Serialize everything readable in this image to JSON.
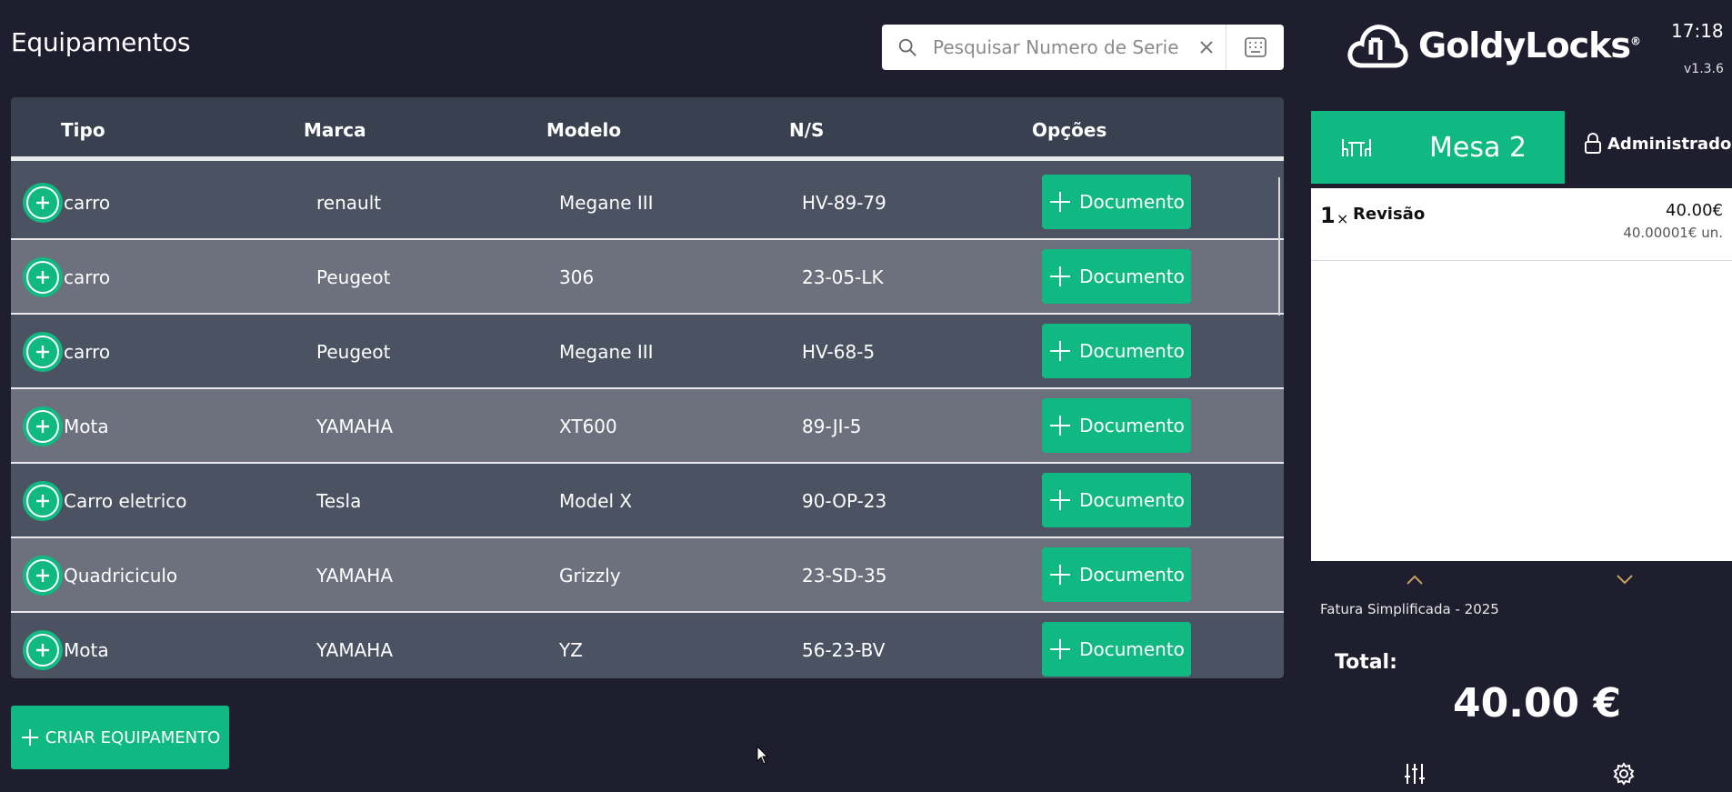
{
  "page": {
    "title": "Equipamentos"
  },
  "search": {
    "placeholder": "Pesquisar Numero de Serie",
    "value": ""
  },
  "table": {
    "headers": {
      "tipo": "Tipo",
      "marca": "Marca",
      "modelo": "Modelo",
      "ns": "N/S",
      "opcoes": "Opções"
    },
    "document_label": "Documento",
    "rows": [
      {
        "tipo": "carro",
        "marca": "renault",
        "modelo": "Megane III",
        "ns": "HV-89-79"
      },
      {
        "tipo": "carro",
        "marca": "Peugeot",
        "modelo": "306",
        "ns": "23-05-LK"
      },
      {
        "tipo": "carro",
        "marca": "Peugeot",
        "modelo": "Megane III",
        "ns": "HV-68-5"
      },
      {
        "tipo": "Mota",
        "marca": "YAMAHA",
        "modelo": "XT600",
        "ns": "89-JI-5"
      },
      {
        "tipo": "Carro eletrico",
        "marca": "Tesla",
        "modelo": "Model X",
        "ns": "90-OP-23"
      },
      {
        "tipo": "Quadriciculo",
        "marca": "YAMAHA",
        "modelo": "Grizzly",
        "ns": "23-SD-35"
      },
      {
        "tipo": "Mota",
        "marca": "YAMAHA",
        "modelo": "YZ",
        "ns": "56-23-BV"
      }
    ]
  },
  "create_button": {
    "label": "CRIAR EQUIPAMENTO"
  },
  "brand": {
    "name": "GoldyLocks",
    "mark": "®"
  },
  "clock": "17:18",
  "version": "v1.3.6",
  "mesa": {
    "label": "Mesa 2"
  },
  "user": {
    "label": "Administrador"
  },
  "order": {
    "lines": [
      {
        "qty": "1",
        "x": "×",
        "name": "Revisão",
        "price": "40.00€",
        "unit_price": "40.00001€ un."
      }
    ]
  },
  "document_type": "Fatura Simplificada - 2025",
  "total": {
    "label": "Total:",
    "value": "40.00 €"
  },
  "colors": {
    "accent": "#10b981",
    "background": "#1e1e2f",
    "table_dark": "#4b5261",
    "table_light": "#6d717e",
    "header": "#39404f"
  }
}
